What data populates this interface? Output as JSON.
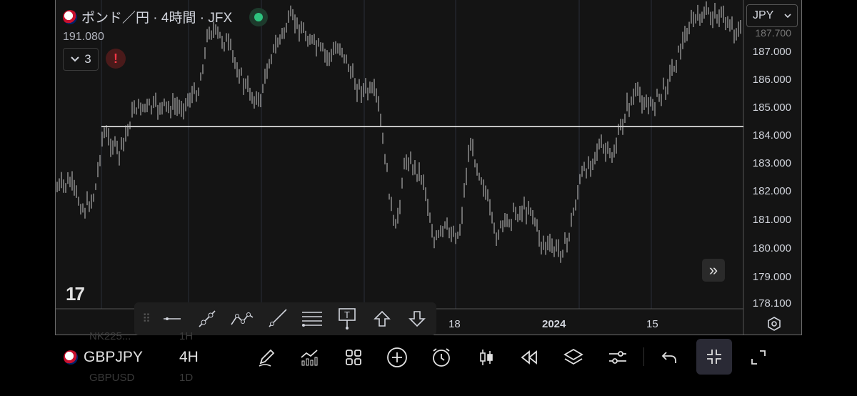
{
  "legend": {
    "title": "ポンド／円 · 4時間 · JFX",
    "price": "191.080",
    "indicators_count": "3",
    "alert": "!"
  },
  "currency": {
    "selected": "JPY",
    "partial_price": "187.700"
  },
  "price_axis": [
    "187.000",
    "186.000",
    "185.000",
    "184.000",
    "183.000",
    "182.000",
    "181.000",
    "180.000",
    "179.000",
    "178.100"
  ],
  "time_axis": {
    "left": "18",
    "year": "2024",
    "right": "15"
  },
  "bottom_bar": {
    "symbol": "GBPJPY",
    "interval": "4H",
    "ghost_symbol": "NK225...",
    "ghost_interval": "1H",
    "ghost_symbol2": "GBPUSD",
    "ghost_interval2": "1D"
  },
  "drawing_tools": [
    "horizontal-line",
    "trend-line",
    "path",
    "ray",
    "fib-levels",
    "text-note",
    "arrow-up",
    "arrow-down"
  ],
  "bottom_tools": [
    "pencil",
    "indicators",
    "layouts",
    "add",
    "alert-clock",
    "candles",
    "replay",
    "layers",
    "settings-sliders",
    "undo",
    "collapse",
    "expand"
  ],
  "colors": {
    "background": "#141414",
    "candles": "#c8c8c8",
    "level_line": "#ffffff",
    "status": "#2ec27e",
    "alert": "#f23645"
  }
}
